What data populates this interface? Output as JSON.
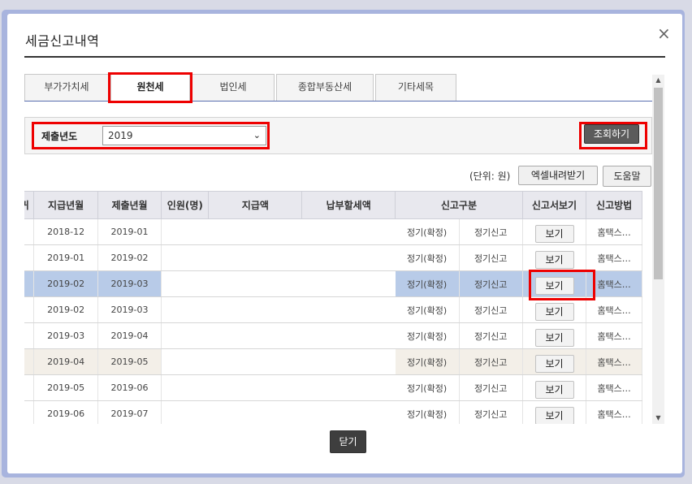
{
  "dialog": {
    "title": "세금신고내역",
    "close_icon": "×"
  },
  "tabs": [
    "부가가치세",
    "원천세",
    "법인세",
    "종합부동산세",
    "기타세목"
  ],
  "active_tab": "원천세",
  "filter": {
    "label": "제출년도",
    "selected_year": "2019",
    "chevron": "⌄",
    "search_button": "조회하기"
  },
  "toolbar": {
    "unit": "(단위: 원)",
    "excel_button": "엑셀내려받기",
    "help_button": "도움말"
  },
  "table": {
    "headers": [
      "귀",
      "지급년월",
      "제출년월",
      "인원(명)",
      "지급액",
      "납부할세액",
      "신고구분",
      "신고서보기",
      "신고방법"
    ],
    "rows": [
      {
        "pay": "2018-12",
        "submit": "2019-01",
        "type1": "정기(확정)",
        "type2": "정기신고",
        "view": "보기",
        "method": "홈택스…"
      },
      {
        "pay": "2019-01",
        "submit": "2019-02",
        "type1": "정기(확정)",
        "type2": "정기신고",
        "view": "보기",
        "method": "홈택스…"
      },
      {
        "pay": "2019-02",
        "submit": "2019-03",
        "type1": "정기(확정)",
        "type2": "정기신고",
        "view": "보기",
        "method": "홈택스…"
      },
      {
        "pay": "2019-02",
        "submit": "2019-03",
        "type1": "정기(확정)",
        "type2": "정기신고",
        "view": "보기",
        "method": "홈택스…"
      },
      {
        "pay": "2019-03",
        "submit": "2019-04",
        "type1": "정기(확정)",
        "type2": "정기신고",
        "view": "보기",
        "method": "홈택스…"
      },
      {
        "pay": "2019-04",
        "submit": "2019-05",
        "type1": "정기(확정)",
        "type2": "정기신고",
        "view": "보기",
        "method": "홈택스…"
      },
      {
        "pay": "2019-05",
        "submit": "2019-06",
        "type1": "정기(확정)",
        "type2": "정기신고",
        "view": "보기",
        "method": "홈택스…"
      },
      {
        "pay": "2019-06",
        "submit": "2019-07",
        "type1": "정기(확정)",
        "type2": "정기신고",
        "view": "보기",
        "method": "홈택스…"
      }
    ]
  },
  "footer": {
    "close_button": "닫기"
  },
  "scrollbar": {
    "up_arrow": "▲",
    "down_arrow": "▼"
  },
  "colors": {
    "highlight": "#ee0000",
    "selected_row": "#b8cbe8",
    "frame": "#a8b4de"
  }
}
